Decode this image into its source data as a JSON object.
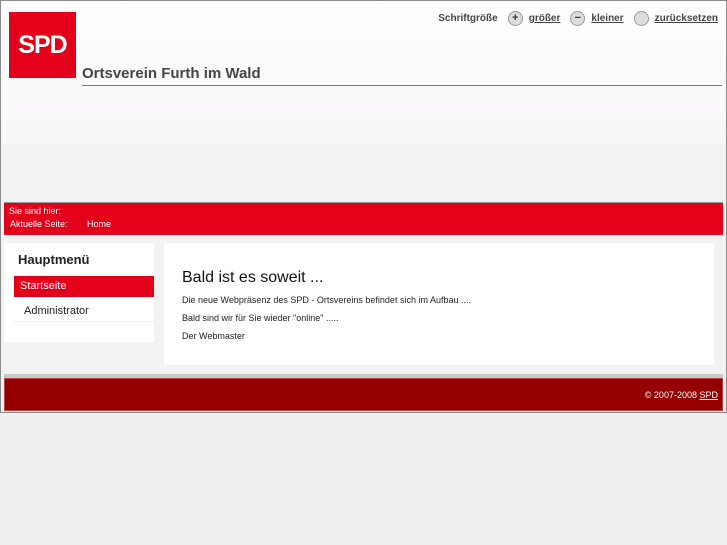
{
  "header": {
    "logo": "SPD",
    "title": "Ortsverein Furth im Wald"
  },
  "fontsize": {
    "label": "Schriftgröße",
    "bigger": "größer",
    "smaller": "kleiner",
    "reset": "zurücksetzen"
  },
  "breadcrumb": {
    "label": "Sie sind hier:",
    "current_label": "Aktuelle Seite:",
    "current": "Home"
  },
  "sidebar": {
    "title": "Hauptmenü",
    "items": [
      {
        "label": "Startseite",
        "active": true
      },
      {
        "label": "Administrator"
      }
    ]
  },
  "content": {
    "heading": "Bald ist es soweit ...",
    "paragraphs": [
      "Die neue Webpräsenz des SPD - Ortsvereins befindet sich im Aufbau ....",
      "Bald sind wir für Sie wieder \"online\" .....",
      "Der Webmaster"
    ]
  },
  "footer": {
    "copyright": "© 2007-2008",
    "link": "SPD"
  },
  "colors": {
    "brand": "#e2001a",
    "footer": "#950000"
  }
}
